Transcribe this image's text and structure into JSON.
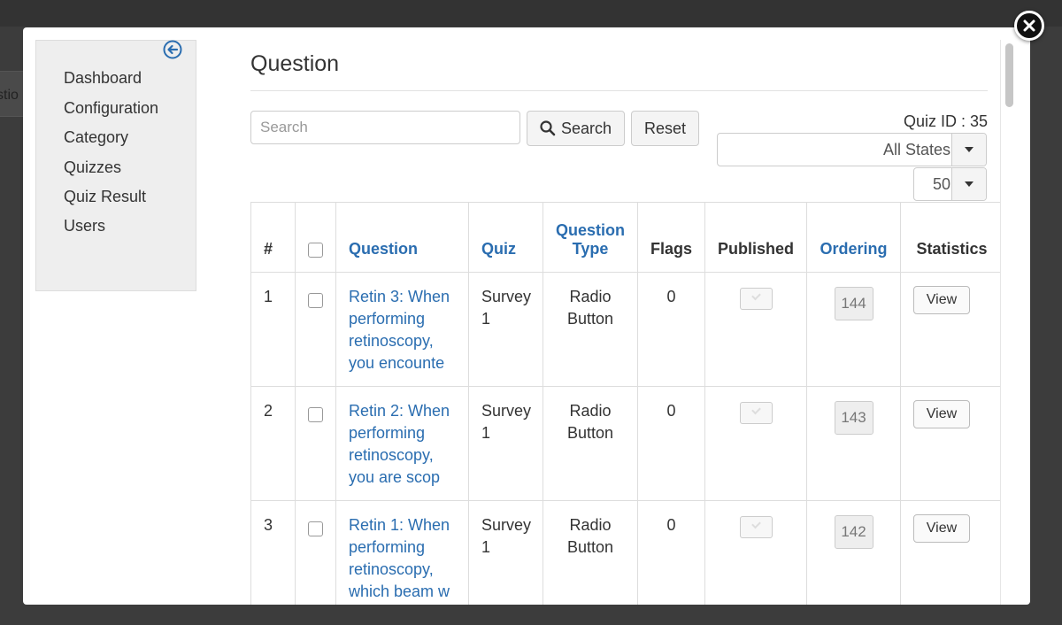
{
  "background": {
    "fragment_text": "stio"
  },
  "sidebar": {
    "items": [
      {
        "label": "Dashboard"
      },
      {
        "label": "Configuration"
      },
      {
        "label": "Category"
      },
      {
        "label": "Quizzes"
      },
      {
        "label": "Quiz Result"
      },
      {
        "label": "Users"
      }
    ],
    "collapse_icon": "arrow-left-circle-icon"
  },
  "page": {
    "title": "Question"
  },
  "toolbar": {
    "search_placeholder": "Search",
    "search_label": "Search",
    "reset_label": "Reset",
    "quiz_id_text": "Quiz ID : 35",
    "state_filter_value": "All States",
    "limit_value": "50"
  },
  "table": {
    "headers": {
      "num": "#",
      "question": "Question",
      "quiz": "Quiz",
      "question_type_line1": "Question",
      "question_type_line2": "Type",
      "flags": "Flags",
      "published": "Published",
      "ordering": "Ordering",
      "statistics": "Statistics"
    },
    "rows": [
      {
        "num": "1",
        "question": "Retin 3: When performing retinoscopy, you encounte",
        "quiz": "Survey 1",
        "type": "Radio Button",
        "flags": "0",
        "ordering": "144",
        "stats_label": "View"
      },
      {
        "num": "2",
        "question": "Retin 2: When performing retinoscopy, you are scop",
        "quiz": "Survey 1",
        "type": "Radio Button",
        "flags": "0",
        "ordering": "143",
        "stats_label": "View"
      },
      {
        "num": "3",
        "question": "Retin 1: When performing retinoscopy, which beam w",
        "quiz": "Survey 1",
        "type": "Radio Button",
        "flags": "0",
        "ordering": "142",
        "stats_label": "View"
      }
    ]
  },
  "colors": {
    "link": "#2a6db0",
    "sidebar_bg": "#eeeeee",
    "overlay": "#3c3c3c"
  }
}
